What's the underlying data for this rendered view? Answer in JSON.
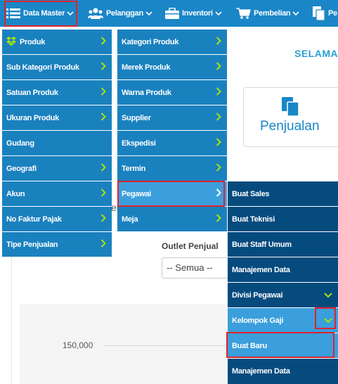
{
  "topnav": {
    "items": [
      {
        "label": "Data Master",
        "icon": "list-icon"
      },
      {
        "label": "Pelanggan",
        "icon": "users-icon"
      },
      {
        "label": "Inventori",
        "icon": "briefcase-icon"
      },
      {
        "label": "Pembelian",
        "icon": "cart-icon"
      },
      {
        "label": "Pe",
        "icon": "documents-icon"
      }
    ]
  },
  "page": {
    "selama": "SELAMA",
    "penjualan_label": "Penjualan",
    "outlet_label": "Outlet Penjual",
    "outlet_value": "-- Semua --",
    "tick_150000": "150,000",
    "stray_char": "er"
  },
  "menu1": {
    "items": [
      "Produk",
      "Sub Kategori Produk",
      "Satuan Produk",
      "Ukuran Produk",
      "Gudang",
      "Geografi",
      "Akun",
      "No Faktur Pajak",
      "Tipe Penjualan"
    ]
  },
  "menu2": {
    "items": [
      "Kategori Produk",
      "Merek Produk",
      "Warna Produk",
      "Supplier",
      "Ekspedisi",
      "Termin",
      "Pegawai",
      "Meja"
    ],
    "active": "Pegawai"
  },
  "menu3": {
    "items": [
      "Buat Sales",
      "Buat Teknisi",
      "Buat Staff Umum",
      "Manajemen Data",
      "Divisi Pegawai",
      "Kelompok Gaji",
      "Buat Baru",
      "Manajemen Data"
    ],
    "active": "Buat Baru"
  },
  "colors": {
    "nav": "#1a86c7",
    "menu": "#1a81bf",
    "menu_dark": "#064b7e",
    "active": "#3a9fdc",
    "arrow": "#a7e10c",
    "highlight": "#e0232b"
  }
}
